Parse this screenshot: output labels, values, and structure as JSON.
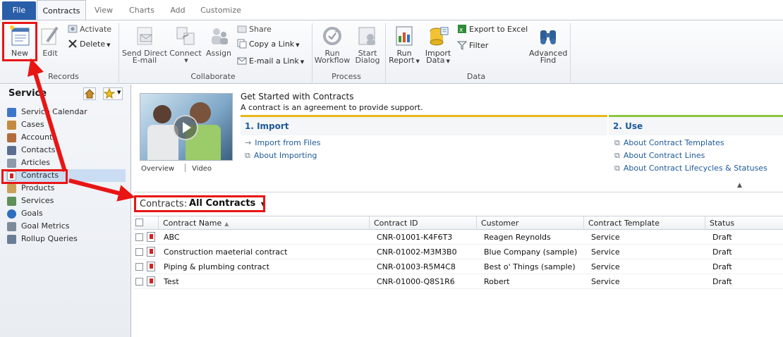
{
  "tabs": [
    {
      "label": "File"
    },
    {
      "label": "Contracts"
    },
    {
      "label": "View"
    },
    {
      "label": "Charts"
    },
    {
      "label": "Add"
    },
    {
      "label": "Customize"
    }
  ],
  "ribbon": {
    "records": {
      "label": "Records",
      "new": "New",
      "edit": "Edit",
      "activate": "Activate",
      "delete": "Delete"
    },
    "collaborate": {
      "label": "Collaborate",
      "send_direct_email": [
        "Send Direct",
        "E-mail"
      ],
      "connect": "Connect",
      "assign": "Assign",
      "share": "Share",
      "copy_link": "Copy a Link",
      "email_link": "E-mail a Link"
    },
    "process": {
      "label": "Process",
      "run_workflow": [
        "Run",
        "Workflow"
      ],
      "start_dialog": [
        "Start",
        "Dialog"
      ]
    },
    "data": {
      "label": "Data",
      "run_report": [
        "Run",
        "Report"
      ],
      "import_data": [
        "Import",
        "Data"
      ],
      "export_excel": "Export to Excel",
      "filter": "Filter",
      "advanced_find": [
        "Advanced",
        "Find"
      ]
    }
  },
  "sidebar": {
    "title": "Service",
    "items": [
      {
        "label": "Service Calendar",
        "icon": "calendar-icon"
      },
      {
        "label": "Cases",
        "icon": "cases-icon"
      },
      {
        "label": "Accounts",
        "icon": "accounts-icon"
      },
      {
        "label": "Contacts",
        "icon": "contacts-icon"
      },
      {
        "label": "Articles",
        "icon": "articles-icon"
      },
      {
        "label": "Contracts",
        "icon": "contracts-icon"
      },
      {
        "label": "Products",
        "icon": "products-icon"
      },
      {
        "label": "Services",
        "icon": "services-icon"
      },
      {
        "label": "Goals",
        "icon": "goals-icon"
      },
      {
        "label": "Goal Metrics",
        "icon": "goal-metrics-icon"
      },
      {
        "label": "Rollup Queries",
        "icon": "rollup-queries-icon"
      }
    ]
  },
  "get_started": {
    "title": "Get Started with Contracts",
    "description": "A contract is an agreement to provide support.",
    "video_tabs": [
      "Overview",
      "Video"
    ],
    "import": {
      "heading": "1. Import",
      "links": [
        "Import from Files",
        "About Importing"
      ]
    },
    "use": {
      "heading": "2. Use",
      "links": [
        "About Contract Templates",
        "About Contract Lines",
        "About Contract Lifecycles & Statuses"
      ]
    }
  },
  "view": {
    "label": "Contracts:",
    "selected": "All Contracts"
  },
  "grid": {
    "columns": [
      "Contract Name",
      "Contract ID",
      "Customer",
      "Contract Template",
      "Status"
    ],
    "rows": [
      [
        "ABC",
        "CNR-01001-K4F6T3",
        "Reagen Reynolds",
        "Service",
        "Draft"
      ],
      [
        "Construction maeterial contract",
        "CNR-01002-M3M3B0",
        "Blue Company (sample)",
        "Service",
        "Draft"
      ],
      [
        "Piping & plumbing contract",
        "CNR-01003-R5M4C8",
        "Best o' Things (sample)",
        "Service",
        "Draft"
      ],
      [
        "Test",
        "CNR-01000-Q8S1R6",
        "Robert",
        "Service",
        "Draft"
      ]
    ]
  },
  "colors": {
    "file_tab": "#2b5ea8",
    "link": "#1e5a9a",
    "annotation": "#e81515",
    "import_bar": "#e8b818",
    "use_bar": "#8cc63f"
  }
}
